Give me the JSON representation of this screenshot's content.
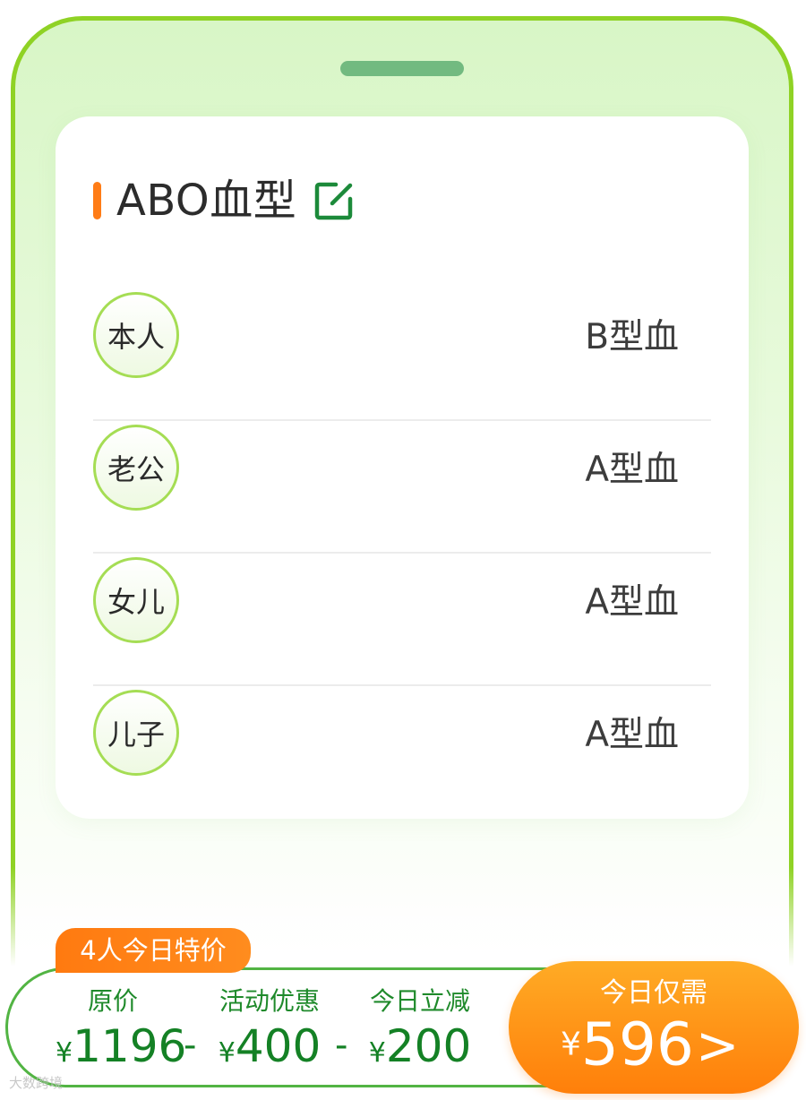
{
  "card": {
    "title": "ABO血型",
    "members": [
      {
        "relation": "本人",
        "blood_type": "B型血"
      },
      {
        "relation": "老公",
        "blood_type": "A型血"
      },
      {
        "relation": "女儿",
        "blood_type": "A型血"
      },
      {
        "relation": "儿子",
        "blood_type": "A型血"
      }
    ]
  },
  "promo": {
    "badge": "4人今日特价",
    "currency": "¥",
    "operator": "-",
    "original_label": "原价",
    "original_value": "1196",
    "activity_label": "活动优惠",
    "activity_value": "400",
    "instant_label": "今日立减",
    "instant_value": "200",
    "final_label": "今日仅需",
    "final_value": "596",
    "final_arrow": ">"
  },
  "watermark": "大数跨境",
  "colors": {
    "frame_green": "#8fd225",
    "accent_orange": "#ff7c16",
    "price_green": "#148125",
    "button_orange": "#ff8c14"
  },
  "icons": {
    "edit": "edit-icon"
  }
}
